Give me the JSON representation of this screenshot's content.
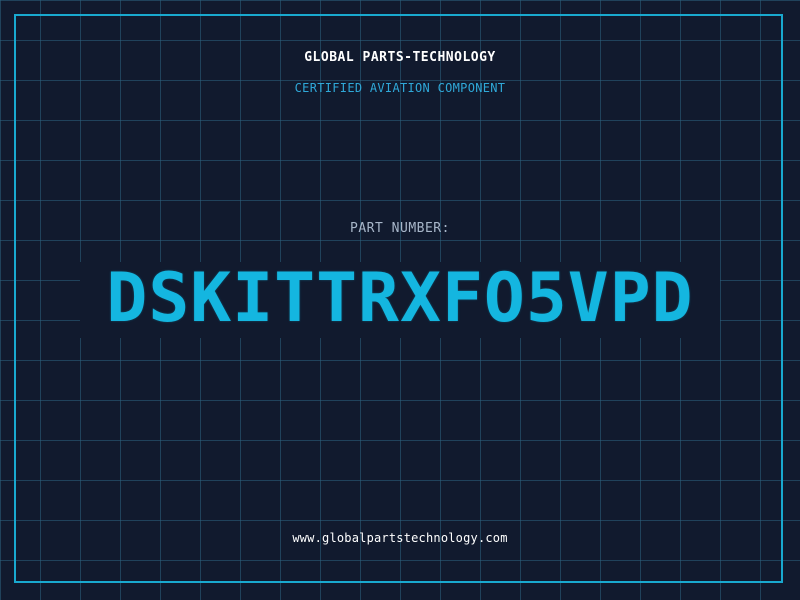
{
  "header": {
    "company": "GLOBAL PARTS-TECHNOLOGY",
    "subtitle": "CERTIFIED AVIATION COMPONENT"
  },
  "part": {
    "label": "PART NUMBER:",
    "number": "DSKITTRXFO5VPD"
  },
  "footer": {
    "url": "www.globalpartstechnology.com"
  },
  "colors": {
    "background": "#111a2e",
    "grid": "#2c6280",
    "frame": "#19a9cf",
    "part_number": "#14b6e0",
    "subtitle": "#2fa8d8",
    "label": "#a8b6c9",
    "text": "#ffffff"
  }
}
